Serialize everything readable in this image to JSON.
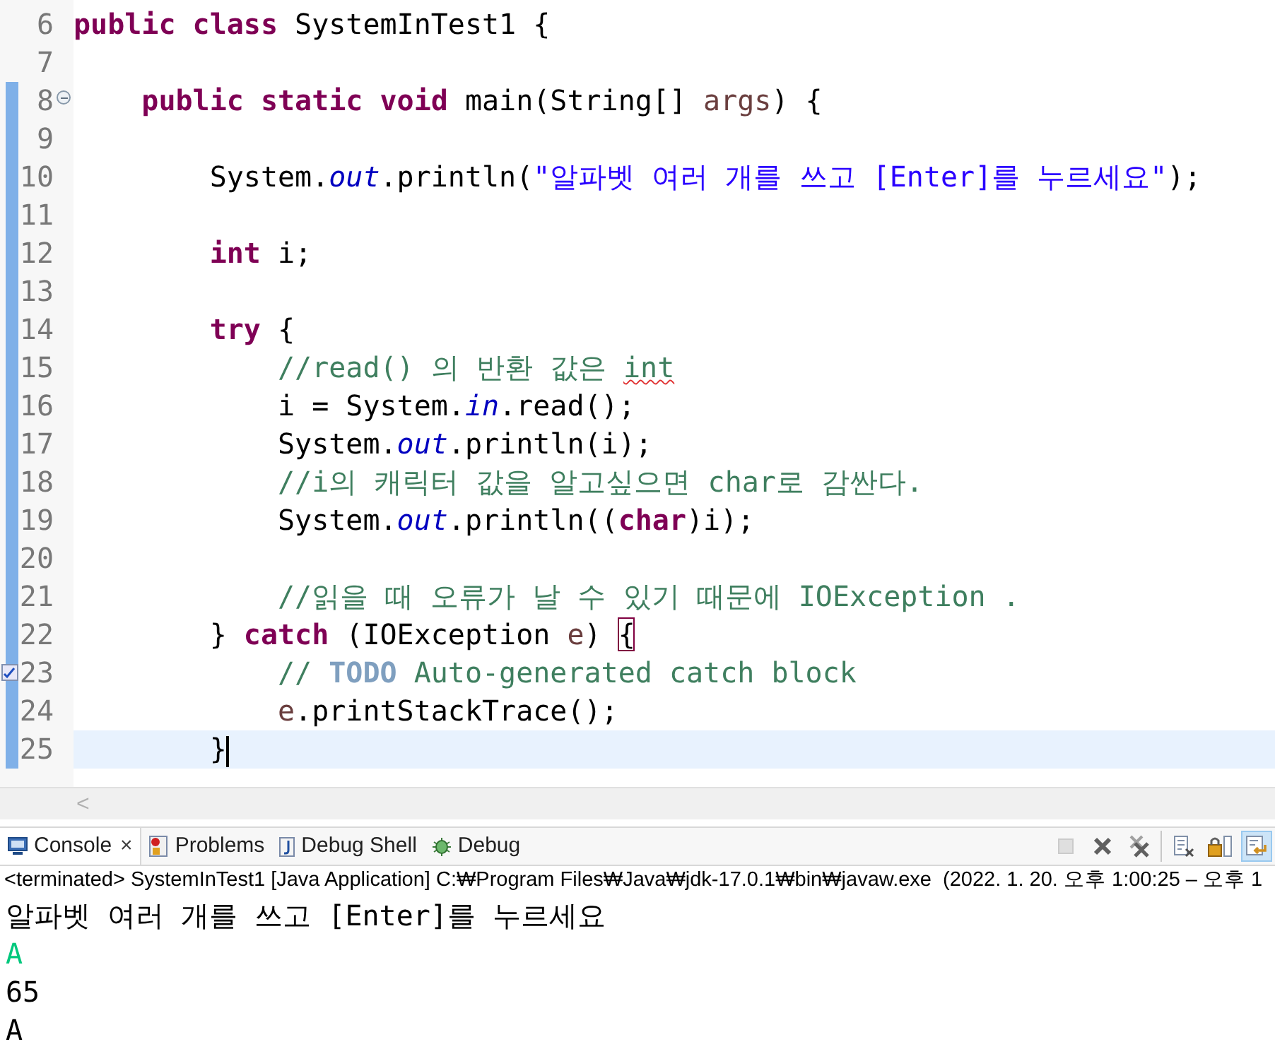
{
  "editor": {
    "lines": [
      {
        "number": "6",
        "changed": false,
        "fold": false,
        "task": false,
        "current": false,
        "tokens": [
          {
            "kind": "keyword",
            "text": "public class"
          },
          {
            "kind": "plain",
            "text": " SystemInTest1 {"
          }
        ]
      },
      {
        "number": "7",
        "changed": false,
        "fold": false,
        "task": false,
        "current": false
      },
      {
        "number": "8",
        "changed": true,
        "fold": true,
        "task": false,
        "current": false,
        "tokens": [
          {
            "kind": "keyword",
            "text": "    public static void"
          },
          {
            "kind": "plain",
            "text": " main(String[] "
          },
          {
            "kind": "variable",
            "text": "args"
          },
          {
            "kind": "plain",
            "text": ") {"
          }
        ]
      },
      {
        "number": "9",
        "changed": true,
        "fold": false,
        "task": false,
        "current": false
      },
      {
        "number": "10",
        "changed": true,
        "fold": false,
        "task": false,
        "current": false,
        "tokens": [
          {
            "kind": "plain",
            "text": "        System."
          },
          {
            "kind": "field",
            "text": "out"
          },
          {
            "kind": "plain",
            "text": ".println("
          },
          {
            "kind": "string",
            "text": "\"알파벳 여러 개를 쓰고 [Enter]를 누르세요\""
          },
          {
            "kind": "plain",
            "text": ");"
          }
        ]
      },
      {
        "number": "11",
        "changed": true,
        "fold": false,
        "task": false,
        "current": false
      },
      {
        "number": "12",
        "changed": true,
        "fold": false,
        "task": false,
        "current": false,
        "tokens": [
          {
            "kind": "keyword",
            "text": "        int"
          },
          {
            "kind": "plain",
            "text": " i;"
          }
        ]
      },
      {
        "number": "13",
        "changed": true,
        "fold": false,
        "task": false,
        "current": false
      },
      {
        "number": "14",
        "changed": true,
        "fold": false,
        "task": false,
        "current": false,
        "tokens": [
          {
            "kind": "keyword",
            "text": "        try"
          },
          {
            "kind": "plain",
            "text": " {"
          }
        ]
      },
      {
        "number": "15",
        "changed": true,
        "fold": false,
        "task": false,
        "current": false,
        "tokens": [
          {
            "kind": "comment",
            "text": "            //read() 의 반환 값은 "
          },
          {
            "kind": "flagged_comment",
            "text": "int"
          }
        ]
      },
      {
        "number": "16",
        "changed": true,
        "fold": false,
        "task": false,
        "current": false,
        "tokens": [
          {
            "kind": "plain",
            "text": "            i = System."
          },
          {
            "kind": "field",
            "text": "in"
          },
          {
            "kind": "plain",
            "text": ".read();"
          }
        ]
      },
      {
        "number": "17",
        "changed": true,
        "fold": false,
        "task": false,
        "current": false,
        "tokens": [
          {
            "kind": "plain",
            "text": "            System."
          },
          {
            "kind": "field",
            "text": "out"
          },
          {
            "kind": "plain",
            "text": ".println(i);"
          }
        ]
      },
      {
        "number": "18",
        "changed": true,
        "fold": false,
        "task": false,
        "current": false,
        "tokens": [
          {
            "kind": "comment",
            "text": "            //i의 캐릭터 값을 알고싶으면 char로 감싼다."
          }
        ]
      },
      {
        "number": "19",
        "changed": true,
        "fold": false,
        "task": false,
        "current": false,
        "tokens": [
          {
            "kind": "plain",
            "text": "            System."
          },
          {
            "kind": "field",
            "text": "out"
          },
          {
            "kind": "plain",
            "text": ".println(("
          },
          {
            "kind": "keyword",
            "text": "char"
          },
          {
            "kind": "plain",
            "text": ")i);"
          }
        ]
      },
      {
        "number": "20",
        "changed": true,
        "fold": false,
        "task": false,
        "current": false
      },
      {
        "number": "21",
        "changed": true,
        "fold": false,
        "task": false,
        "current": false,
        "tokens": [
          {
            "kind": "comment",
            "text": "            //읽을 때 오류가 날 수 있기 때문에 IOException ."
          }
        ]
      },
      {
        "number": "22",
        "changed": true,
        "fold": false,
        "task": false,
        "current": false,
        "tokens": [
          {
            "kind": "plain",
            "text": "        } "
          },
          {
            "kind": "keyword",
            "text": "catch"
          },
          {
            "kind": "plain",
            "text": " (IOException "
          },
          {
            "kind": "variable",
            "text": "e"
          },
          {
            "kind": "plain",
            "text": ") "
          },
          {
            "kind": "matched_bracket",
            "text": "{"
          }
        ]
      },
      {
        "number": "23",
        "changed": true,
        "fold": false,
        "task": true,
        "current": false,
        "tokens": [
          {
            "kind": "comment",
            "text": "            // "
          },
          {
            "kind": "todo",
            "text": "TODO"
          },
          {
            "kind": "comment",
            "text": " Auto-generated catch block"
          }
        ]
      },
      {
        "number": "24",
        "changed": true,
        "fold": false,
        "task": false,
        "current": false,
        "tokens": [
          {
            "kind": "variable",
            "text": "            e"
          },
          {
            "kind": "plain",
            "text": ".printStackTrace();"
          }
        ]
      },
      {
        "number": "25",
        "changed": true,
        "fold": false,
        "task": false,
        "current": true,
        "tokens": [
          {
            "kind": "plain",
            "text": "        }"
          }
        ]
      }
    ],
    "scroll_arrow": "<"
  },
  "console": {
    "tabs": [
      {
        "kind": "console",
        "label": "Console",
        "selected": true,
        "close": "×"
      },
      {
        "kind": "problems",
        "label": "Problems",
        "selected": false
      },
      {
        "kind": "shell",
        "label": "Debug Shell",
        "selected": false
      },
      {
        "kind": "debug",
        "label": "Debug",
        "selected": false
      }
    ],
    "toolbar": [
      {
        "kind": "stop",
        "disabled": true,
        "on": false
      },
      {
        "kind": "remove",
        "disabled": false,
        "on": false
      },
      {
        "kind": "remove_all",
        "disabled": false,
        "on": false
      },
      {
        "kind": "clear",
        "disabled": false,
        "on": false
      },
      {
        "kind": "lock",
        "disabled": false,
        "on": false
      },
      {
        "kind": "show",
        "disabled": false,
        "on": true
      }
    ],
    "status": "<terminated> SystemInTest1 [Java Application] C:₩Program Files₩Java₩jdk-17.0.1₩bin₩javaw.exe  (2022. 1. 20. 오후 1:00:25 – 오후 1",
    "output": [
      {
        "kind": "output",
        "text": "알파벳 여러 개를 쓰고 [Enter]를 누르세요"
      },
      {
        "kind": "input",
        "text": "A"
      },
      {
        "kind": "output",
        "text": "65"
      },
      {
        "kind": "output",
        "text": "A"
      }
    ]
  }
}
